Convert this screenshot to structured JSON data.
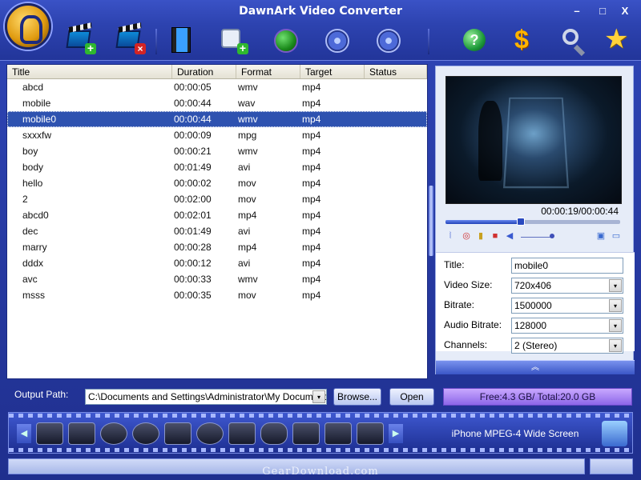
{
  "window": {
    "title": "DawnArk Video Converter",
    "min": "–",
    "max": "□",
    "close": "X"
  },
  "table": {
    "headers": [
      "Title",
      "Duration",
      "Format",
      "Target",
      "Status"
    ],
    "rows": [
      {
        "title": "abcd",
        "duration": "00:00:05",
        "format": "wmv",
        "target": "mp4",
        "status": ""
      },
      {
        "title": "mobile",
        "duration": "00:00:44",
        "format": "wav",
        "target": "mp4",
        "status": ""
      },
      {
        "title": "mobile0",
        "duration": "00:00:44",
        "format": "wmv",
        "target": "mp4",
        "status": ""
      },
      {
        "title": "sxxxfw",
        "duration": "00:00:09",
        "format": "mpg",
        "target": "mp4",
        "status": ""
      },
      {
        "title": "boy",
        "duration": "00:00:21",
        "format": "wmv",
        "target": "mp4",
        "status": ""
      },
      {
        "title": "body",
        "duration": "00:01:49",
        "format": "avi",
        "target": "mp4",
        "status": ""
      },
      {
        "title": "hello",
        "duration": "00:00:02",
        "format": "mov",
        "target": "mp4",
        "status": ""
      },
      {
        "title": "2",
        "duration": "00:02:00",
        "format": "mov",
        "target": "mp4",
        "status": ""
      },
      {
        "title": "abcd0",
        "duration": "00:02:01",
        "format": "mp4",
        "target": "mp4",
        "status": ""
      },
      {
        "title": "dec",
        "duration": "00:01:49",
        "format": "avi",
        "target": "mp4",
        "status": ""
      },
      {
        "title": "marry",
        "duration": "00:00:28",
        "format": "mp4",
        "target": "mp4",
        "status": ""
      },
      {
        "title": "dddx",
        "duration": "00:00:12",
        "format": "avi",
        "target": "mp4",
        "status": ""
      },
      {
        "title": "avc",
        "duration": "00:00:33",
        "format": "wmv",
        "target": "mp4",
        "status": ""
      },
      {
        "title": "msss",
        "duration": "00:00:35",
        "format": "mov",
        "target": "mp4",
        "status": ""
      }
    ],
    "selected_index": 2
  },
  "player": {
    "timecode": "00:00:19/00:00:44",
    "progress_fraction": 0.43
  },
  "properties": {
    "title_label": "Title:",
    "title_value": "mobile0",
    "video_size_label": "Video Size:",
    "video_size_value": "720x406",
    "bitrate_label": "Bitrate:",
    "bitrate_value": "1500000",
    "audio_bitrate_label": "Audio Bitrate:",
    "audio_bitrate_value": "128000",
    "channels_label": "Channels:",
    "channels_value": "2 (Stereo)"
  },
  "output": {
    "label": "Output Path:",
    "path": "C:\\Documents and Settings\\Administrator\\My Documents",
    "browse_label": "Browse...",
    "open_label": "Open",
    "space": "Free:4.3 GB/ Total:20.0 GB"
  },
  "devices": {
    "selected_name": "iPhone MPEG-4 Wide Screen"
  },
  "watermark": "GearDownload.com",
  "icons": {
    "dropdown": "▾",
    "collapse": "︽",
    "left_arrow": "◀",
    "right_arrow": "▶",
    "plus": "+",
    "cross": "×",
    "help": "?",
    "dollar": "$",
    "star": "★"
  },
  "colors": {
    "selected_row": "#2e52b0",
    "toolbar": "#2d43b0",
    "free_bar": "#a886f4"
  }
}
